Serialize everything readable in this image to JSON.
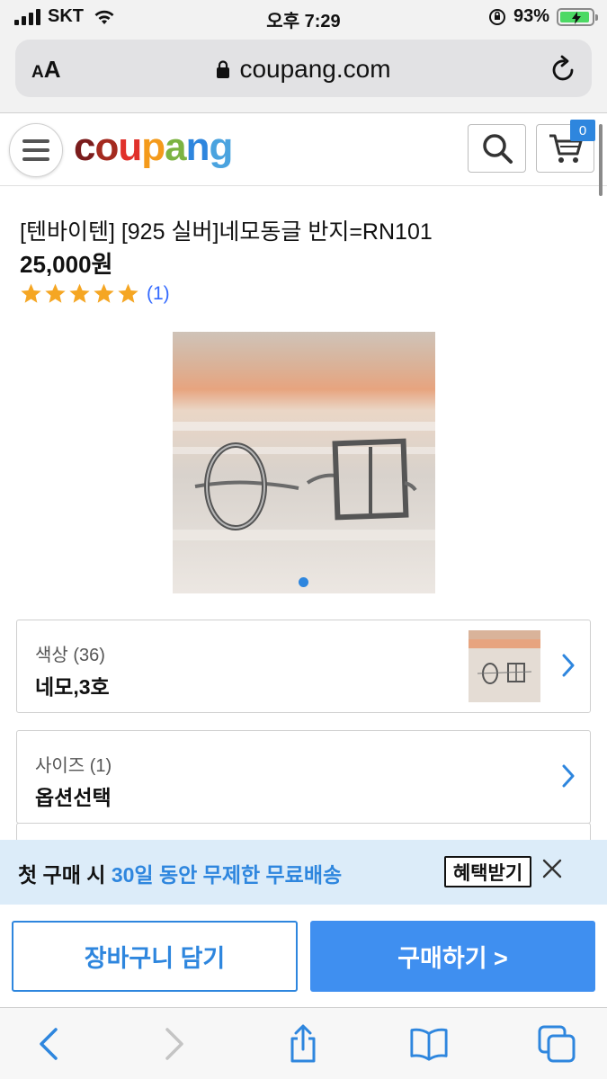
{
  "status_bar": {
    "carrier": "SKT",
    "time": "오후 7:29",
    "battery_percent": "93%",
    "battery_level": 0.93
  },
  "browser": {
    "text_size_label": "AA",
    "url": "coupang.com"
  },
  "header": {
    "logo_letters": [
      "c",
      "o",
      "u",
      "p",
      "a",
      "n",
      "g"
    ],
    "logo_colors": [
      "#7a1c1c",
      "#a42a1f",
      "#e0312b",
      "#f49a1b",
      "#7cb342",
      "#2e86de",
      "#4aa3df"
    ],
    "cart_count": "0"
  },
  "product": {
    "title": "[텐바이텐] [925 실버]네모동글 반지=RN101",
    "price": "25,000원",
    "rating_stars": 5,
    "rating_count": "(1)",
    "star_color": "#f5a623"
  },
  "options": [
    {
      "label": "색상 (36)",
      "value": "네모,3호"
    },
    {
      "label": "사이즈 (1)",
      "value": "옵션선택"
    }
  ],
  "promo": {
    "text_prefix": "첫 구매 시 ",
    "text_highlight": "30일 동안 무제한 무료배송",
    "button": "혜택받기"
  },
  "actions": {
    "add_to_cart": "장바구니 담기",
    "buy_now": "구매하기 >"
  },
  "colors": {
    "accent_blue": "#2e86de",
    "buy_button": "#3f8ff0",
    "promo_bg": "#dcecf9"
  }
}
